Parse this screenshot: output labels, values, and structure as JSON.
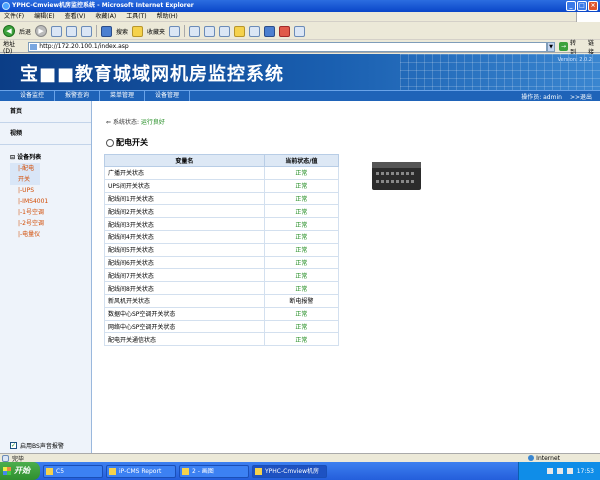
{
  "window": {
    "title": "YPHC-Cmview机房监控系统 - Microsoft Internet Explorer"
  },
  "browser": {
    "menus": [
      "文件(F)",
      "编辑(E)",
      "查看(V)",
      "收藏(A)",
      "工具(T)",
      "帮助(H)"
    ],
    "back_label": "后退",
    "search_label": "搜索",
    "favorites_label": "收藏夹",
    "address_label": "地址(D)",
    "address_value": "http://172.20.100.1/index.asp",
    "go_label": "转到",
    "links_label": "链接"
  },
  "app": {
    "banner_title": "宝■■教育城域网机房监控系统",
    "version": "Version: 2.0.2",
    "nav": [
      "设备监控",
      "报警查询",
      "菜单管理",
      "设备管理"
    ],
    "operator": "操作员: admin",
    "logout": ">>退出"
  },
  "sidebar": {
    "home": "首页",
    "video": "视频",
    "tree_root": "设备列表",
    "tree_items": [
      "|-配电开关",
      "|-UPS",
      "|-IMS4001",
      "|-1号空调",
      "|-2号空调",
      "|-电量仪"
    ],
    "sound_alarm_label": "启用BS声音报警"
  },
  "content": {
    "status_label": "系统状态:",
    "status_value": "运行良好",
    "section_title": "配电开关",
    "table": {
      "headers": [
        "变量名",
        "当前状态/值"
      ],
      "rows": [
        {
          "name": "广播开关状态",
          "value": "正常"
        },
        {
          "name": "UPS间开关状态",
          "value": "正常"
        },
        {
          "name": "配线间1开关状态",
          "value": "正常"
        },
        {
          "name": "配线间2开关状态",
          "value": "正常"
        },
        {
          "name": "配线间3开关状态",
          "value": "正常"
        },
        {
          "name": "配线间4开关状态",
          "value": "正常"
        },
        {
          "name": "配线间5开关状态",
          "value": "正常"
        },
        {
          "name": "配线间6开关状态",
          "value": "正常"
        },
        {
          "name": "配线间7开关状态",
          "value": "正常"
        },
        {
          "name": "配线间8开关状态",
          "value": "正常"
        },
        {
          "name": "新风机开关状态",
          "value": "断电报警"
        },
        {
          "name": "数据中心SP空调开关状态",
          "value": "正常"
        },
        {
          "name": "网络中心SP空调开关状态",
          "value": "正常"
        },
        {
          "name": "配电开关通信状态",
          "value": "正常"
        }
      ]
    }
  },
  "statusbar": {
    "left": "完毕",
    "zone": "Internet"
  },
  "taskbar": {
    "start": "开始",
    "tasks": [
      "C5",
      "iP-CMS Report",
      "2 - 画图",
      "YPHC-Cmview机房"
    ],
    "clock": "17:53"
  },
  "colors": {
    "status_ok": "#1c8a1c",
    "tree_item": "#d24a00",
    "banner": "#0b3d86"
  }
}
